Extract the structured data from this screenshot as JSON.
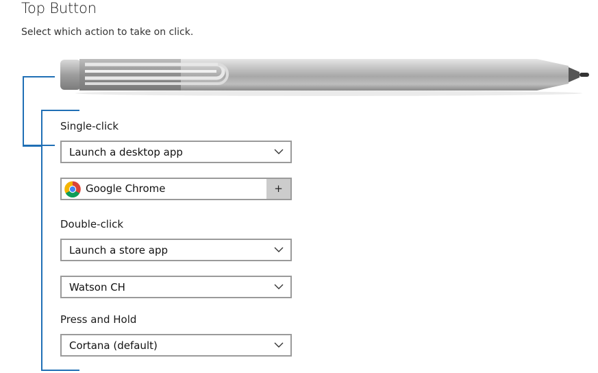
{
  "header": {
    "title": "Top Button",
    "subtitle": "Select which action to take on click."
  },
  "sections": {
    "single_click": {
      "label": "Single-click",
      "action_value": "Launch a desktop app",
      "app_name": "Google Chrome",
      "add_label": "+"
    },
    "double_click": {
      "label": "Double-click",
      "action_value": "Launch a store app",
      "app_value": "Watson CH"
    },
    "press_and_hold": {
      "label": "Press and Hold",
      "action_value": "Cortana (default)"
    }
  },
  "icons": {
    "chevron": "chevron-down-icon",
    "app": "chrome-icon",
    "pen": "surface-pen-illustration"
  },
  "colors": {
    "bracket": "#1f6fb5",
    "border": "#9a9a9a",
    "button_bg": "#cccccc"
  }
}
